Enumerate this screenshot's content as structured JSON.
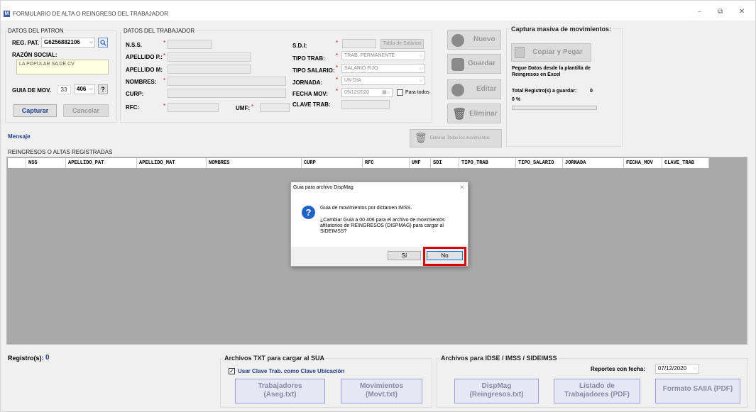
{
  "window": {
    "title": "FORMULARIO DE ALTA O REINGRESO DEL TRABAJADOR",
    "icon": "M",
    "controls": [
      "–",
      "⧉",
      "✕"
    ]
  },
  "patron": {
    "group_title": "DATOS DEL PATRON",
    "reg_pat_label": "REG. PAT.",
    "reg_pat_value": "G6256882106",
    "razon_label": "RAZÓN SOCIAL:",
    "razon_value": "LA POPULAR SA DE CV",
    "guia_label": "GUIA DE MOV.",
    "guia_num": "33",
    "guia_sel": "406",
    "help_label": "?",
    "capturar": "Capturar",
    "cancelar": "Cancelar"
  },
  "trabajador": {
    "group_title": "DATOS DEL TRABAJADOR",
    "nss": "N.S.S.",
    "apellido_p": "APELLIDO P.:",
    "apellido_m": "APELLIDO M:",
    "nombres": "NOMBRES:",
    "curp": "CURP:",
    "rfc": "RFC:",
    "umf": "UMF:",
    "sdi": "S.D.I:",
    "tabla_salarios": "Tabla de Salarios",
    "tipo_trab": "TIPO TRAB:",
    "tipo_trab_value": "TRAB. PERMANENTE",
    "tipo_salario": "TIPO SALARIO:",
    "tipo_salario_value": "SALARIO FIJO",
    "jornada": "JORNADA:",
    "jornada_value": "UN DIA",
    "fecha_mov": "FECHA MOV:",
    "fecha_mov_value": "09/12/2020",
    "para_todos": "Para todos",
    "clave_trab": "CLAVE TRAB:",
    "req": "*"
  },
  "actions": {
    "nuevo": "Nuevo",
    "guardar": "Guardar",
    "editar": "Editar",
    "eliminar": "Eliminar",
    "eliminar_todos": "Eliminar Todos los movimientos"
  },
  "captura": {
    "title": "Captura masiva de movimientos:",
    "copiar": "Copiar y Pegar",
    "desc": "Pegue Datos desde la plantilla de Reingresos en Excel",
    "total_label": "Total Registro(s) a guardar:",
    "total_value": "0",
    "percent": "0 %",
    "progress": 0
  },
  "mensaje": "Mensaje",
  "grid": {
    "title": "REINGRESOS O ALTAS REGISTRADAS",
    "columns": [
      "NSS",
      "APELLIDO_PAT",
      "APELLIDO_MAT",
      "NOMBRES",
      "CURP",
      "RFC",
      "UMF",
      "SDI",
      "TIPO_TRAB",
      "TIPO_SALARIO",
      "JORNADA",
      "FECHA_MOV",
      "CLAVE_TRAB"
    ]
  },
  "dialog": {
    "title": "Guia para archivo DispMag",
    "line1": "Guia de movimientos por dictamen IMSS.",
    "line2": "¿Cambiar Guia a 00 406 para el archivo de movimientos afiliatorios de REINGRESOS (DISPMAG) para cargar al SIDEIMSS?",
    "yes": "Sí",
    "no": "No",
    "highlight_color": "#e00000"
  },
  "footer": {
    "registros_label": "Registro(s):",
    "registros_value": "0",
    "sua_title": "Archivos  TXT para cargar al SUA",
    "usar_clave": "Usar Clave Trab. como Clave Ubicación",
    "usar_clave_checked": true,
    "trabajadores": "Trabajadores",
    "trabajadores_sub": "(Aseg.txt)",
    "movimientos": "Movimientos",
    "movimientos_sub": "(Movt.txt)",
    "idse_title": "Archivos para IDSE / IMSS / SIDEIMSS",
    "reportes_label": "Reportes con fecha:",
    "reportes_value": "07/12/2020",
    "dispmag": "DispMag",
    "dispmag_sub": "(Reingresos.txt)",
    "listado": "Listado de",
    "listado_sub": "Trabajadores (PDF)",
    "formato": "Formato SAIIA (PDF)"
  }
}
